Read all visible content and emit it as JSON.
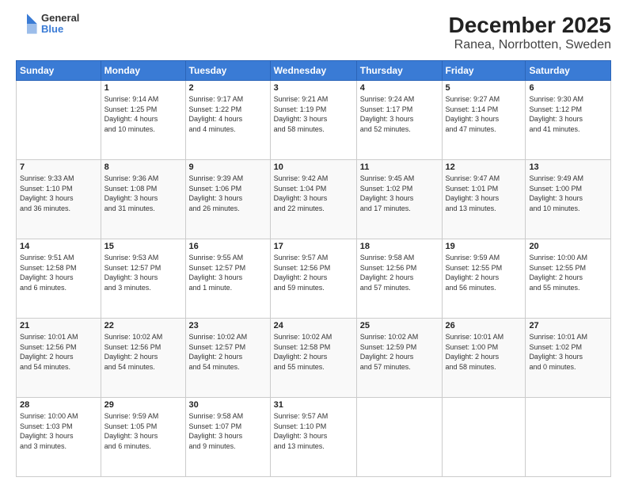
{
  "logo": {
    "line1": "General",
    "line2": "Blue"
  },
  "title": "December 2025",
  "subtitle": "Ranea, Norrbotten, Sweden",
  "header_days": [
    "Sunday",
    "Monday",
    "Tuesday",
    "Wednesday",
    "Thursday",
    "Friday",
    "Saturday"
  ],
  "weeks": [
    [
      {
        "day": "",
        "info": ""
      },
      {
        "day": "1",
        "info": "Sunrise: 9:14 AM\nSunset: 1:25 PM\nDaylight: 4 hours\nand 10 minutes."
      },
      {
        "day": "2",
        "info": "Sunrise: 9:17 AM\nSunset: 1:22 PM\nDaylight: 4 hours\nand 4 minutes."
      },
      {
        "day": "3",
        "info": "Sunrise: 9:21 AM\nSunset: 1:19 PM\nDaylight: 3 hours\nand 58 minutes."
      },
      {
        "day": "4",
        "info": "Sunrise: 9:24 AM\nSunset: 1:17 PM\nDaylight: 3 hours\nand 52 minutes."
      },
      {
        "day": "5",
        "info": "Sunrise: 9:27 AM\nSunset: 1:14 PM\nDaylight: 3 hours\nand 47 minutes."
      },
      {
        "day": "6",
        "info": "Sunrise: 9:30 AM\nSunset: 1:12 PM\nDaylight: 3 hours\nand 41 minutes."
      }
    ],
    [
      {
        "day": "7",
        "info": "Sunrise: 9:33 AM\nSunset: 1:10 PM\nDaylight: 3 hours\nand 36 minutes."
      },
      {
        "day": "8",
        "info": "Sunrise: 9:36 AM\nSunset: 1:08 PM\nDaylight: 3 hours\nand 31 minutes."
      },
      {
        "day": "9",
        "info": "Sunrise: 9:39 AM\nSunset: 1:06 PM\nDaylight: 3 hours\nand 26 minutes."
      },
      {
        "day": "10",
        "info": "Sunrise: 9:42 AM\nSunset: 1:04 PM\nDaylight: 3 hours\nand 22 minutes."
      },
      {
        "day": "11",
        "info": "Sunrise: 9:45 AM\nSunset: 1:02 PM\nDaylight: 3 hours\nand 17 minutes."
      },
      {
        "day": "12",
        "info": "Sunrise: 9:47 AM\nSunset: 1:01 PM\nDaylight: 3 hours\nand 13 minutes."
      },
      {
        "day": "13",
        "info": "Sunrise: 9:49 AM\nSunset: 1:00 PM\nDaylight: 3 hours\nand 10 minutes."
      }
    ],
    [
      {
        "day": "14",
        "info": "Sunrise: 9:51 AM\nSunset: 12:58 PM\nDaylight: 3 hours\nand 6 minutes."
      },
      {
        "day": "15",
        "info": "Sunrise: 9:53 AM\nSunset: 12:57 PM\nDaylight: 3 hours\nand 3 minutes."
      },
      {
        "day": "16",
        "info": "Sunrise: 9:55 AM\nSunset: 12:57 PM\nDaylight: 3 hours\nand 1 minute."
      },
      {
        "day": "17",
        "info": "Sunrise: 9:57 AM\nSunset: 12:56 PM\nDaylight: 2 hours\nand 59 minutes."
      },
      {
        "day": "18",
        "info": "Sunrise: 9:58 AM\nSunset: 12:56 PM\nDaylight: 2 hours\nand 57 minutes."
      },
      {
        "day": "19",
        "info": "Sunrise: 9:59 AM\nSunset: 12:55 PM\nDaylight: 2 hours\nand 56 minutes."
      },
      {
        "day": "20",
        "info": "Sunrise: 10:00 AM\nSunset: 12:55 PM\nDaylight: 2 hours\nand 55 minutes."
      }
    ],
    [
      {
        "day": "21",
        "info": "Sunrise: 10:01 AM\nSunset: 12:56 PM\nDaylight: 2 hours\nand 54 minutes."
      },
      {
        "day": "22",
        "info": "Sunrise: 10:02 AM\nSunset: 12:56 PM\nDaylight: 2 hours\nand 54 minutes."
      },
      {
        "day": "23",
        "info": "Sunrise: 10:02 AM\nSunset: 12:57 PM\nDaylight: 2 hours\nand 54 minutes."
      },
      {
        "day": "24",
        "info": "Sunrise: 10:02 AM\nSunset: 12:58 PM\nDaylight: 2 hours\nand 55 minutes."
      },
      {
        "day": "25",
        "info": "Sunrise: 10:02 AM\nSunset: 12:59 PM\nDaylight: 2 hours\nand 57 minutes."
      },
      {
        "day": "26",
        "info": "Sunrise: 10:01 AM\nSunset: 1:00 PM\nDaylight: 2 hours\nand 58 minutes."
      },
      {
        "day": "27",
        "info": "Sunrise: 10:01 AM\nSunset: 1:02 PM\nDaylight: 3 hours\nand 0 minutes."
      }
    ],
    [
      {
        "day": "28",
        "info": "Sunrise: 10:00 AM\nSunset: 1:03 PM\nDaylight: 3 hours\nand 3 minutes."
      },
      {
        "day": "29",
        "info": "Sunrise: 9:59 AM\nSunset: 1:05 PM\nDaylight: 3 hours\nand 6 minutes."
      },
      {
        "day": "30",
        "info": "Sunrise: 9:58 AM\nSunset: 1:07 PM\nDaylight: 3 hours\nand 9 minutes."
      },
      {
        "day": "31",
        "info": "Sunrise: 9:57 AM\nSunset: 1:10 PM\nDaylight: 3 hours\nand 13 minutes."
      },
      {
        "day": "",
        "info": ""
      },
      {
        "day": "",
        "info": ""
      },
      {
        "day": "",
        "info": ""
      }
    ]
  ]
}
